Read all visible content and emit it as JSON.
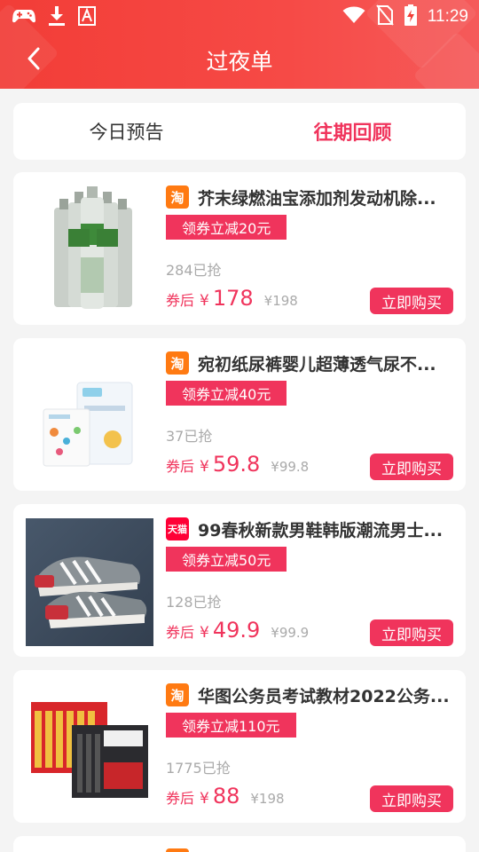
{
  "status_bar": {
    "time": "11:29",
    "left_icons": [
      "gamepad-icon",
      "download-icon",
      "font-icon"
    ],
    "right_icons": [
      "wifi-icon",
      "no-sim-icon",
      "battery-charging-icon"
    ]
  },
  "nav": {
    "title": "过夜单",
    "back_icon": "chevron-left-icon"
  },
  "tabs": [
    {
      "label": "今日预告",
      "active": false
    },
    {
      "label": "往期回顾",
      "active": true
    }
  ],
  "products": [
    {
      "platform": "taobao",
      "platform_label": "淘",
      "title": "芥末绿燃油宝添加剂发动机除...",
      "coupon": "领券立减20元",
      "sold": "284已抢",
      "price_label": "券后",
      "currency": "¥",
      "price": "178",
      "original_price": "¥198",
      "buy_label": "立即购买"
    },
    {
      "platform": "taobao",
      "platform_label": "淘",
      "title": "宛初纸尿裤婴儿超薄透气尿不...",
      "coupon": "领券立减40元",
      "sold": "37已抢",
      "price_label": "券后",
      "currency": "¥",
      "price": "59.8",
      "original_price": "¥99.8",
      "buy_label": "立即购买"
    },
    {
      "platform": "tmall",
      "platform_label": "天猫",
      "title": "99春秋新款男鞋韩版潮流男士...",
      "coupon": "领券立减50元",
      "sold": "128已抢",
      "price_label": "券后",
      "currency": "¥",
      "price": "49.9",
      "original_price": "¥99.9",
      "buy_label": "立即购买"
    },
    {
      "platform": "taobao",
      "platform_label": "淘",
      "title": "华图公务员考试教材2022公务...",
      "coupon": "领券立减110元",
      "sold": "1775已抢",
      "price_label": "券后",
      "currency": "¥",
      "price": "88",
      "original_price": "¥198",
      "buy_label": "立即购买"
    }
  ],
  "colors": {
    "header": "#f23d37",
    "accent": "#f0345c",
    "taobao": "#ff7a12",
    "tmall": "#ff0036"
  }
}
